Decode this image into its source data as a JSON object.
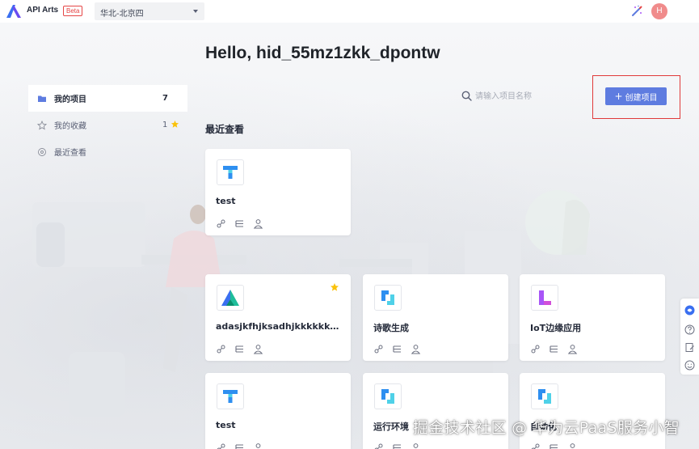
{
  "header": {
    "app_title": "API Arts",
    "beta_label": "Beta",
    "region": "华北-北京四",
    "avatar_initial": "H"
  },
  "greeting": "Hello, hid_55mz1zkk_dpontw",
  "sidebar": {
    "items": [
      {
        "label": "我的项目",
        "count": "7",
        "icon": "folder-icon"
      },
      {
        "label": "我的收藏",
        "count": "1",
        "icon": "star-outline-icon"
      },
      {
        "label": "最近查看",
        "count": "",
        "icon": "recent-icon"
      }
    ]
  },
  "search": {
    "placeholder": "请输入项目名称",
    "value": ""
  },
  "create_button": {
    "label": "创建项目"
  },
  "recent_title": "最近查看",
  "projects": [
    {
      "name": "test",
      "logo": "T",
      "favorite": false
    },
    {
      "name": "adasjkfhjksadhjkkkkkkhjkkkkkk",
      "logo": "A",
      "favorite": true
    },
    {
      "name": "诗歌生成",
      "logo": "bracket",
      "favorite": false
    },
    {
      "name": "IoT边缘应用",
      "logo": "L",
      "favorite": false
    },
    {
      "name": "test",
      "logo": "T",
      "favorite": false
    },
    {
      "name": "运行环境",
      "logo": "bracket",
      "favorite": false
    },
    {
      "name": "自动化",
      "logo": "bracket",
      "favorite": false
    }
  ],
  "colors": {
    "primary": "#5e7ce0",
    "favorite": "#fac20a",
    "highlight": "#e03a3a"
  },
  "watermark": "掘金技术社区 @ 华为云PaaS服务小智"
}
